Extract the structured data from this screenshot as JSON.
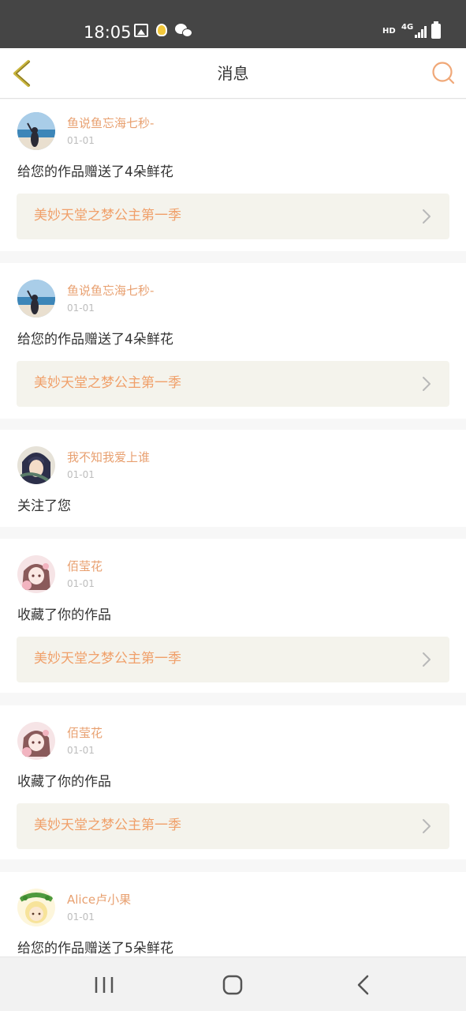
{
  "status_bar": {
    "time": "18:05",
    "hd": "HD",
    "network": "4G",
    "icons": [
      "gallery-icon",
      "bulb-icon",
      "wechat-icon",
      "signal-icon",
      "battery-icon"
    ]
  },
  "header": {
    "title": "消息",
    "back_icon": "chevron-left-icon",
    "search_icon": "search-icon",
    "accent_color": "#e8a070",
    "back_color": "#c9b53c"
  },
  "messages": [
    {
      "user": "鱼说鱼忘海七秒-",
      "date": "01-01",
      "text": "给您的作品赠送了4朵鲜花",
      "work": "美妙天堂之梦公主第一季",
      "avatar": "sea-girl"
    },
    {
      "user": "鱼说鱼忘海七秒-",
      "date": "01-01",
      "text": "给您的作品赠送了4朵鲜花",
      "work": "美妙天堂之梦公主第一季",
      "avatar": "sea-girl"
    },
    {
      "user": "我不知我爱上谁",
      "date": "01-01",
      "text": "关注了您",
      "avatar": "anime-boy"
    },
    {
      "user": "佰莹花",
      "date": "01-01",
      "text": "收藏了你的作品",
      "work": "美妙天堂之梦公主第一季",
      "avatar": "anime-girl-pink"
    },
    {
      "user": "佰莹花",
      "date": "01-01",
      "text": "收藏了你的作品",
      "work": "美妙天堂之梦公主第一季",
      "avatar": "anime-girl-pink"
    },
    {
      "user": "Alice卢小果",
      "date": "01-01",
      "text": "给您的作品赠送了5朵鲜花",
      "avatar": "flower-crown-girl"
    }
  ],
  "nav_bar": {
    "recents_icon": "recents-icon",
    "home_icon": "home-icon",
    "back_icon": "back-icon"
  }
}
